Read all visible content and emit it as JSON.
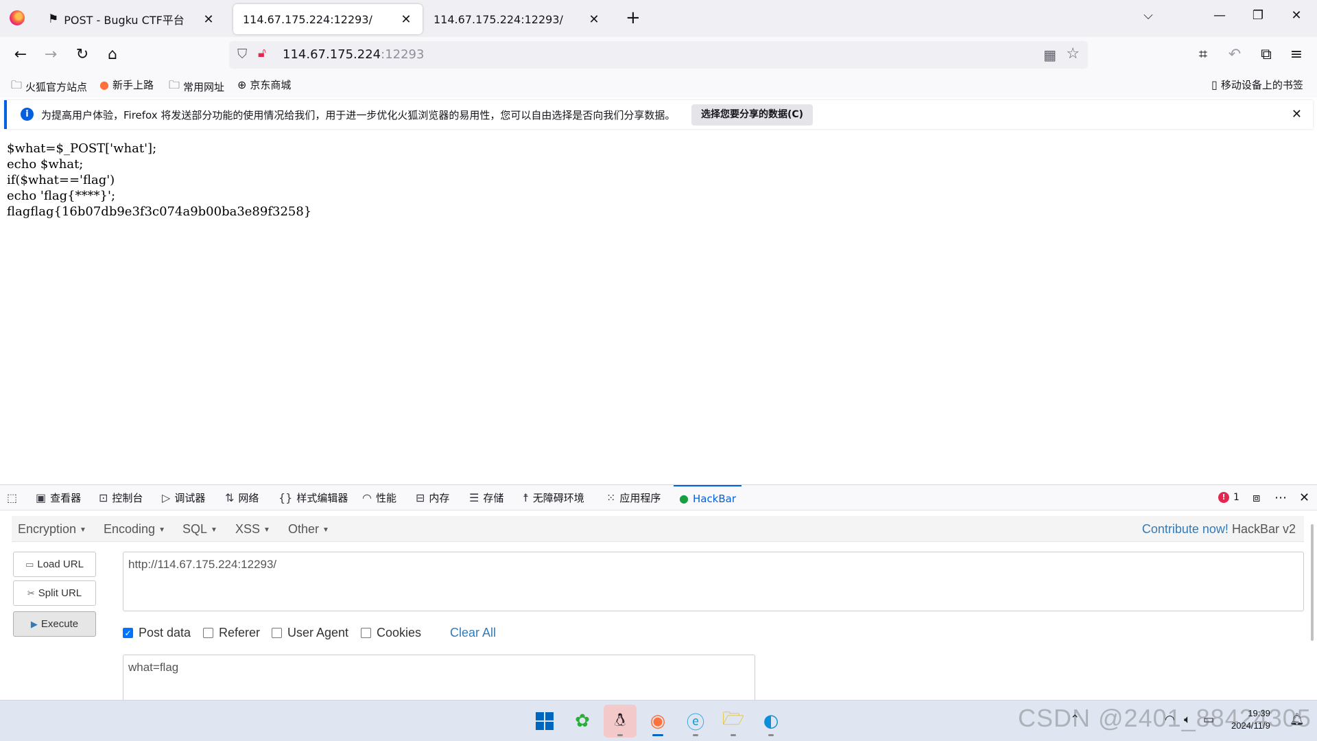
{
  "tabs": [
    {
      "title": "POST - Bugku CTF平台",
      "icon": "flag-icon"
    },
    {
      "title": "114.67.175.224:12293/",
      "active": true
    },
    {
      "title": "114.67.175.224:12293/"
    }
  ],
  "url": {
    "host": "114.67.175.224",
    "port": ":12293"
  },
  "bookmarks": [
    {
      "label": "火狐官方站点",
      "icon": "folder-icon"
    },
    {
      "label": "新手上路",
      "icon": "firefox-icon"
    },
    {
      "label": "常用网址",
      "icon": "folder-icon"
    },
    {
      "label": "京东商城",
      "icon": "globe-icon"
    },
    {
      "label": "移动设备上的书签",
      "icon": "mobile-icon"
    }
  ],
  "infobar": {
    "message": "为提高用户体验，Firefox 将发送部分功能的使用情况给我们，用于进一步优化火狐浏览器的易用性，您可以自由选择是否向我们分享数据。",
    "button": "选择您要分享的数据(C)"
  },
  "page_lines": [
    "$what=$_POST['what'];",
    "echo $what;",
    "if($what=='flag')",
    "echo 'flag{****}';",
    "flagflag{16b07db9e3f3c074a9b00ba3e89f3258}"
  ],
  "devtools": {
    "tabs": [
      "查看器",
      "控制台",
      "调试器",
      "网络",
      "样式编辑器",
      "性能",
      "内存",
      "存储",
      "无障碍环境",
      "应用程序",
      "HackBar"
    ],
    "error_count": "1"
  },
  "hackbar": {
    "menu": [
      "Encryption",
      "Encoding",
      "SQL",
      "XSS",
      "Other"
    ],
    "contribute_link": "Contribute now!",
    "version": "HackBar v2",
    "buttons": {
      "load": "Load URL",
      "split": "Split URL",
      "execute": "Execute"
    },
    "url_value": "http://114.67.175.224:12293/",
    "checks": [
      {
        "label": "Post data",
        "checked": true
      },
      {
        "label": "Referer",
        "checked": false
      },
      {
        "label": "User Agent",
        "checked": false
      },
      {
        "label": "Cookies",
        "checked": false
      }
    ],
    "clear_all": "Clear All",
    "post_value": "what=flag"
  },
  "taskbar": {
    "time": "19:39",
    "date": "2024/11/9"
  },
  "watermark": "CSDN @2401_88424305",
  "colors": {
    "accent": "#0060df",
    "hackbar_link": "#337ab7",
    "error": "#e22850"
  }
}
